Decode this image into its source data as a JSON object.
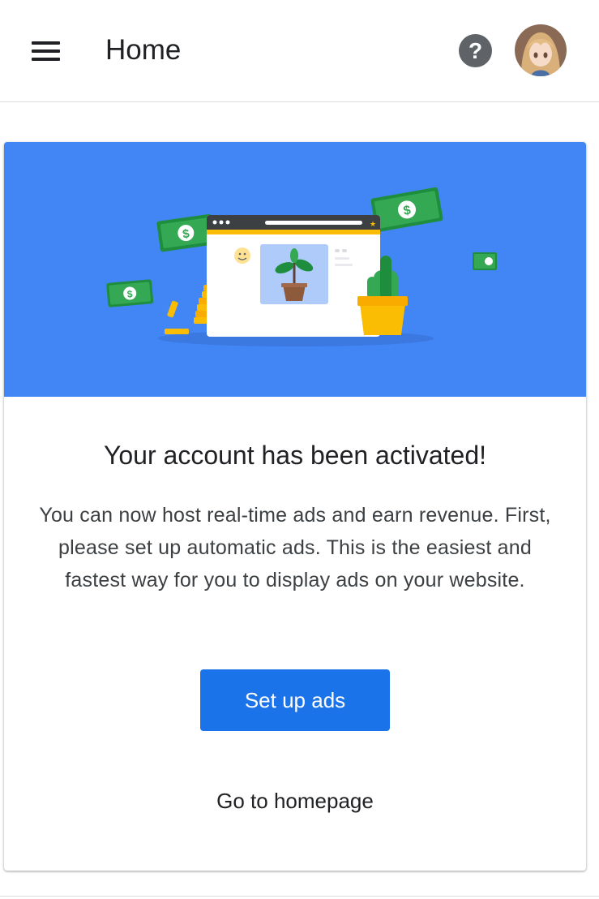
{
  "header": {
    "title": "Home",
    "menu_icon": "hamburger-menu-icon",
    "help_icon": "help-circle-icon",
    "help_glyph": "?",
    "avatar_icon": "user-avatar"
  },
  "card": {
    "title": "Your account has been activated!",
    "body": "You can now host real-time ads and earn revenue. First, please set up automatic ads. This is the easiest and fastest way for you to display ads on your website.",
    "primary_button": "Set up ads",
    "secondary_link": "Go to homepage"
  },
  "colors": {
    "hero_background": "#4285f4",
    "primary_button": "#1a73e8",
    "money_green": "#34a853",
    "coin_yellow": "#fbbc04"
  }
}
